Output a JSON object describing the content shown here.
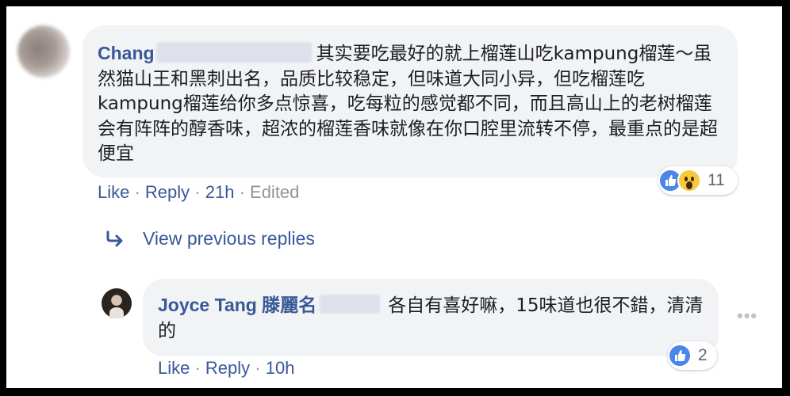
{
  "comment": {
    "author": "Chang",
    "text": "其实要吃最好的就上榴莲山吃kampung榴莲～虽然猫山王和黑刺出名，品质比较稳定，但味道大同小异，但吃榴莲吃kampung榴莲给你多点惊喜，吃每粒的感觉都不同，而且高山上的老树榴莲会有阵阵的醇香味，超浓的榴莲香味就像在你口腔里流转不停，最重点的是超便宜",
    "reaction_count": "11",
    "reactions": [
      "like-icon",
      "wow-icon"
    ],
    "actions": {
      "like": "Like",
      "sep": " · ",
      "reply": "Reply",
      "time": "21h",
      "edited": "Edited"
    }
  },
  "view_previous_replies": "View previous replies",
  "reply": {
    "author": "Joyce Tang 滕麗名",
    "text": "各自有喜好嘛，15味道也很不錯，清清的",
    "reaction_count": "2",
    "reactions": [
      "like-icon"
    ],
    "actions": {
      "like": "Like",
      "sep": " · ",
      "reply": "Reply",
      "time": "10h"
    }
  },
  "colors": {
    "link": "#385898",
    "bubble": "#f2f3f5",
    "meta": "#90949c",
    "like": "#4b86e8",
    "wow": "#f9c93c"
  }
}
